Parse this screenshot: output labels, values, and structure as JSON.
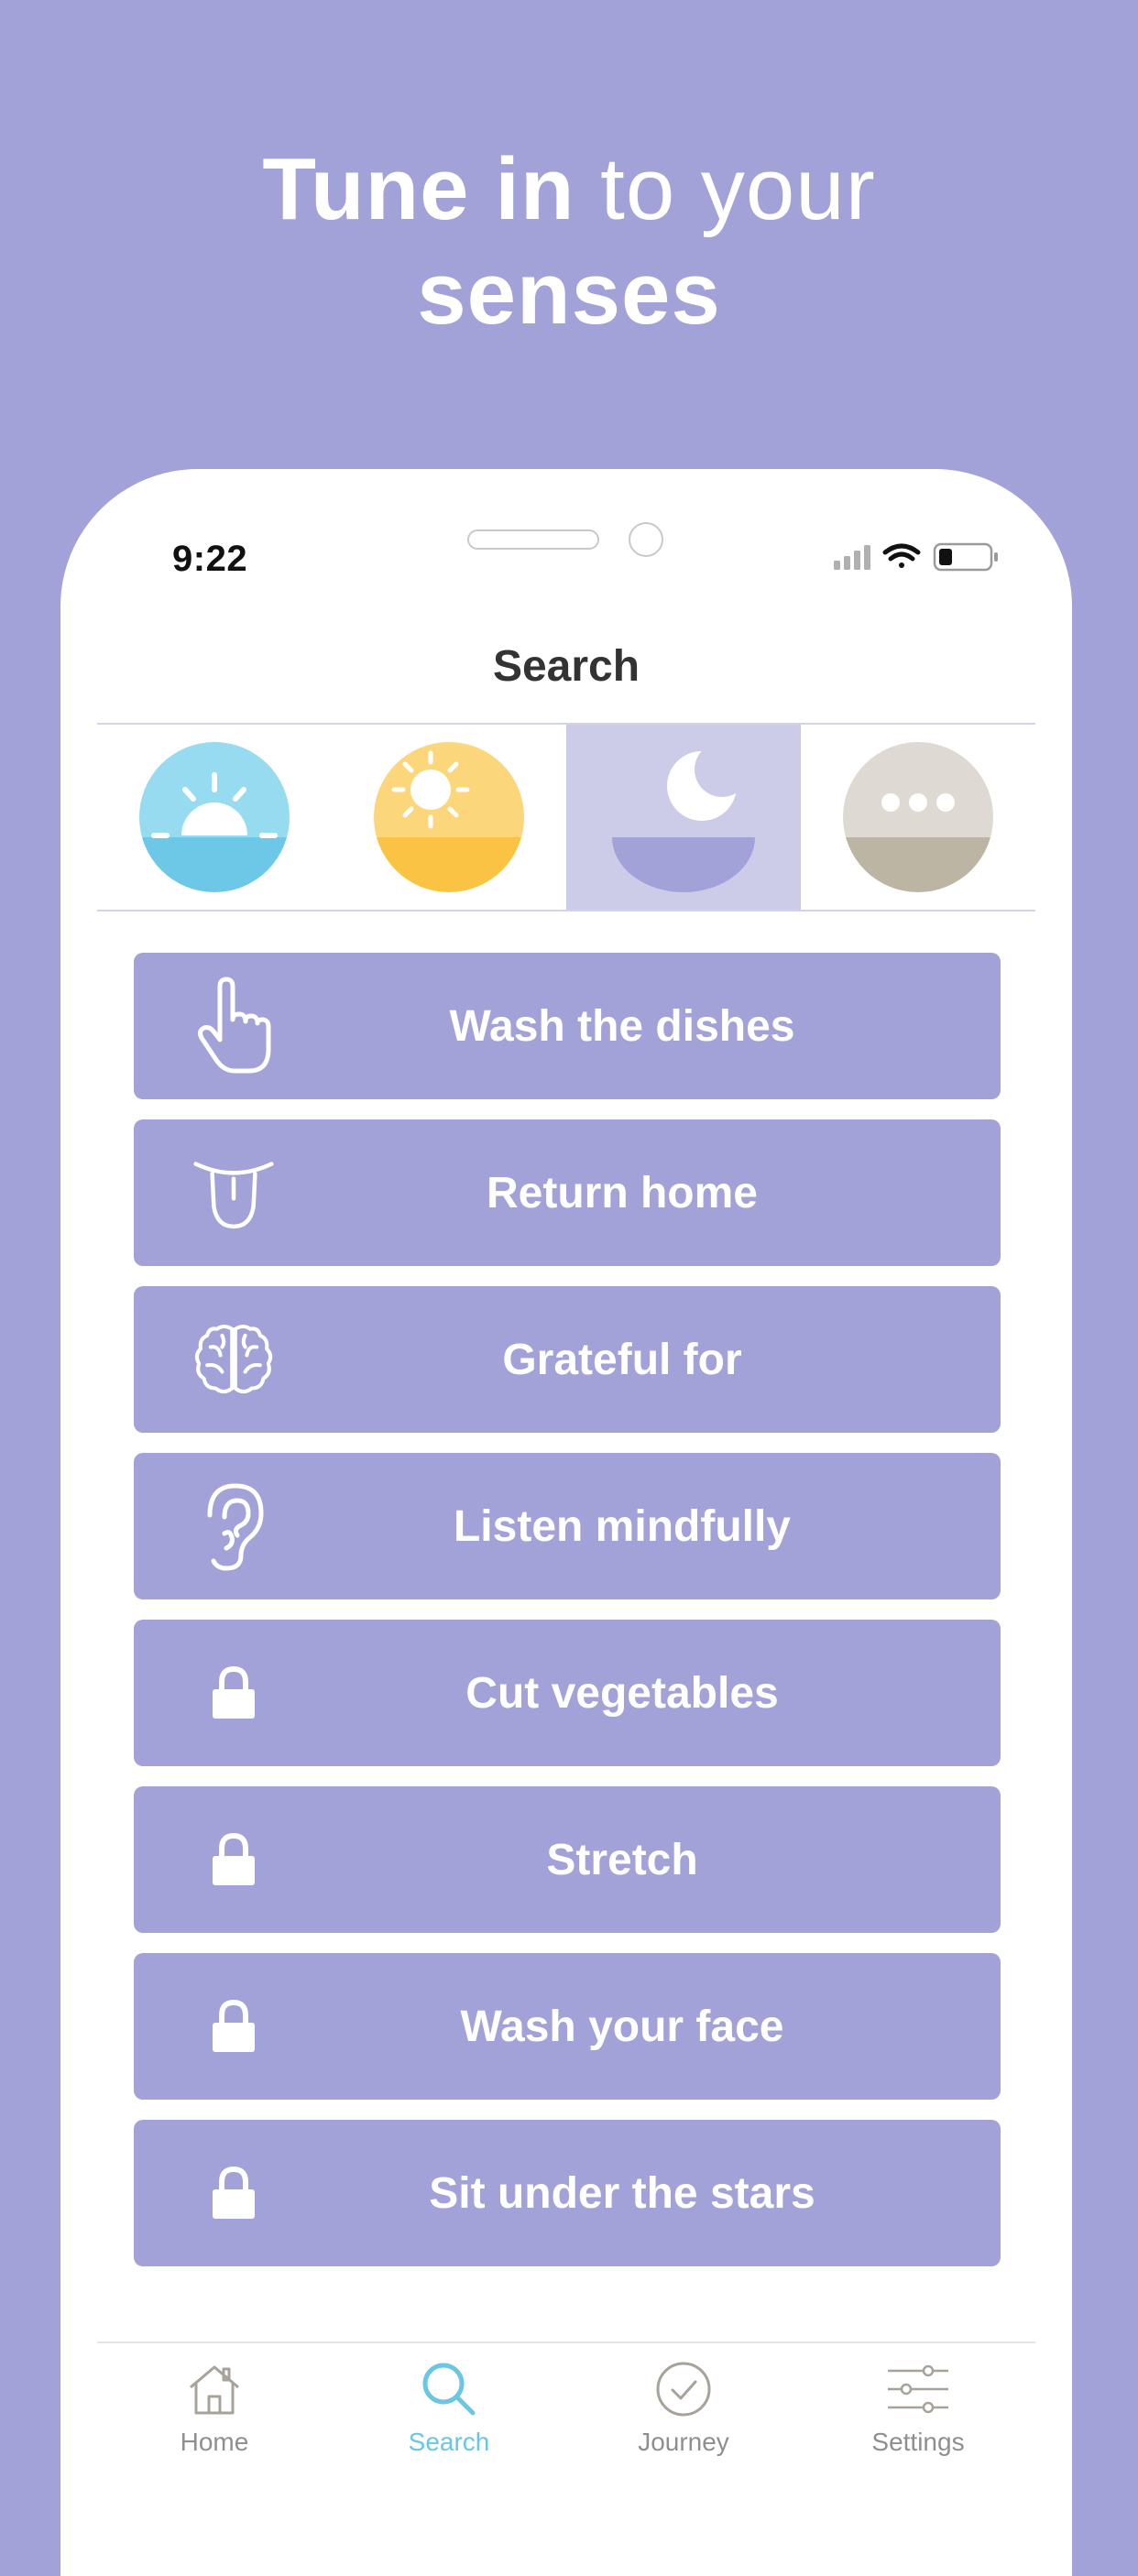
{
  "headline": {
    "bold_1": "Tune in",
    "light": " to your",
    "bold_2": "senses"
  },
  "status_bar": {
    "time": "9:22"
  },
  "screen": {
    "title": "Search"
  },
  "categories": [
    {
      "name": "sunrise",
      "icon": "sunrise-icon",
      "color": "#6cc8e6",
      "selected": false
    },
    {
      "name": "day",
      "icon": "sun-icon",
      "color": "#fac343",
      "selected": false
    },
    {
      "name": "night",
      "icon": "moon-icon",
      "color": "#a2a2d8",
      "selected": true
    },
    {
      "name": "more",
      "icon": "more-icon",
      "color": "#bdb5a4",
      "selected": false
    }
  ],
  "items": [
    {
      "label": "Wash the dishes",
      "icon": "hand-pointer-icon",
      "locked": false
    },
    {
      "label": "Return home",
      "icon": "tongue-icon",
      "locked": false
    },
    {
      "label": "Grateful for",
      "icon": "brain-icon",
      "locked": false
    },
    {
      "label": "Listen mindfully",
      "icon": "ear-icon",
      "locked": false
    },
    {
      "label": "Cut vegetables",
      "icon": "lock-icon",
      "locked": true
    },
    {
      "label": "Stretch",
      "icon": "lock-icon",
      "locked": true
    },
    {
      "label": "Wash your face",
      "icon": "lock-icon",
      "locked": true
    },
    {
      "label": "Sit under the stars",
      "icon": "lock-icon",
      "locked": true
    }
  ],
  "tabbar": [
    {
      "label": "Home",
      "icon": "home-icon",
      "active": false
    },
    {
      "label": "Search",
      "icon": "search-icon",
      "active": true
    },
    {
      "label": "Journey",
      "icon": "check-circle-icon",
      "active": false
    },
    {
      "label": "Settings",
      "icon": "sliders-icon",
      "active": false
    }
  ],
  "colors": {
    "background": "#a2a2d8",
    "item_fill": "#a2a2d8",
    "selected_category": "#cccce8",
    "active_tab": "#6ac6e4",
    "inactive_tab": "#8f8f8f"
  }
}
